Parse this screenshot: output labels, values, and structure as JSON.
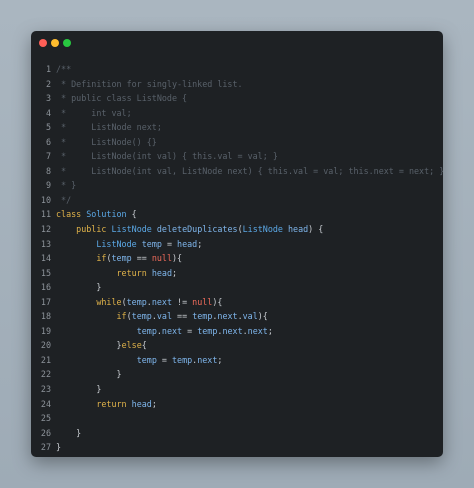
{
  "window": {
    "controls": {
      "close_color": "#fe5f57",
      "minimize_color": "#febc2e",
      "maximize_color": "#28c840"
    }
  },
  "editor": {
    "language": "java",
    "lines": [
      {
        "number": "1",
        "tokens": [
          {
            "t": "/**",
            "k": "comment"
          }
        ]
      },
      {
        "number": "2",
        "tokens": [
          {
            "t": " * Definition for singly-linked list.",
            "k": "comment"
          }
        ]
      },
      {
        "number": "3",
        "tokens": [
          {
            "t": " * public class ListNode {",
            "k": "comment"
          }
        ]
      },
      {
        "number": "4",
        "tokens": [
          {
            "t": " *     int val;",
            "k": "comment"
          }
        ]
      },
      {
        "number": "5",
        "tokens": [
          {
            "t": " *     ListNode next;",
            "k": "comment"
          }
        ]
      },
      {
        "number": "6",
        "tokens": [
          {
            "t": " *     ListNode() {}",
            "k": "comment"
          }
        ]
      },
      {
        "number": "7",
        "tokens": [
          {
            "t": " *     ListNode(int val) { this.val = val; }",
            "k": "comment"
          }
        ]
      },
      {
        "number": "8",
        "tokens": [
          {
            "t": " *     ListNode(int val, ListNode next) { this.val = val; this.next = next; }",
            "k": "comment"
          }
        ]
      },
      {
        "number": "9",
        "tokens": [
          {
            "t": " * }",
            "k": "comment"
          }
        ]
      },
      {
        "number": "10",
        "tokens": [
          {
            "t": " */",
            "k": "comment"
          }
        ]
      },
      {
        "number": "11",
        "tokens": [
          {
            "t": "class",
            "k": "keyword"
          },
          {
            "t": " ",
            "k": "plain"
          },
          {
            "t": "Solution",
            "k": "type"
          },
          {
            "t": " {",
            "k": "plain"
          }
        ]
      },
      {
        "number": "12",
        "tokens": [
          {
            "t": "    ",
            "k": "plain"
          },
          {
            "t": "public",
            "k": "keyword"
          },
          {
            "t": " ",
            "k": "plain"
          },
          {
            "t": "ListNode",
            "k": "type"
          },
          {
            "t": " ",
            "k": "plain"
          },
          {
            "t": "deleteDuplicates",
            "k": "ident"
          },
          {
            "t": "(",
            "k": "plain"
          },
          {
            "t": "ListNode",
            "k": "type"
          },
          {
            "t": " ",
            "k": "plain"
          },
          {
            "t": "head",
            "k": "ident"
          },
          {
            "t": ") {",
            "k": "plain"
          }
        ]
      },
      {
        "number": "13",
        "tokens": [
          {
            "t": "        ",
            "k": "plain"
          },
          {
            "t": "ListNode",
            "k": "type"
          },
          {
            "t": " ",
            "k": "plain"
          },
          {
            "t": "temp",
            "k": "ident"
          },
          {
            "t": " = ",
            "k": "plain"
          },
          {
            "t": "head",
            "k": "ident"
          },
          {
            "t": ";",
            "k": "plain"
          }
        ]
      },
      {
        "number": "14",
        "tokens": [
          {
            "t": "        ",
            "k": "plain"
          },
          {
            "t": "if",
            "k": "keyword"
          },
          {
            "t": "(",
            "k": "plain"
          },
          {
            "t": "temp",
            "k": "ident"
          },
          {
            "t": " == ",
            "k": "plain"
          },
          {
            "t": "null",
            "k": "null"
          },
          {
            "t": "){",
            "k": "plain"
          }
        ]
      },
      {
        "number": "15",
        "tokens": [
          {
            "t": "            ",
            "k": "plain"
          },
          {
            "t": "return",
            "k": "keyword"
          },
          {
            "t": " ",
            "k": "plain"
          },
          {
            "t": "head",
            "k": "ident"
          },
          {
            "t": ";",
            "k": "plain"
          }
        ]
      },
      {
        "number": "16",
        "tokens": [
          {
            "t": "        }",
            "k": "plain"
          }
        ]
      },
      {
        "number": "17",
        "tokens": [
          {
            "t": "        ",
            "k": "plain"
          },
          {
            "t": "while",
            "k": "keyword"
          },
          {
            "t": "(",
            "k": "plain"
          },
          {
            "t": "temp",
            "k": "ident"
          },
          {
            "t": ".",
            "k": "plain"
          },
          {
            "t": "next",
            "k": "ident"
          },
          {
            "t": " != ",
            "k": "plain"
          },
          {
            "t": "null",
            "k": "null"
          },
          {
            "t": "){",
            "k": "plain"
          }
        ]
      },
      {
        "number": "18",
        "tokens": [
          {
            "t": "            ",
            "k": "plain"
          },
          {
            "t": "if",
            "k": "keyword"
          },
          {
            "t": "(",
            "k": "plain"
          },
          {
            "t": "temp",
            "k": "ident"
          },
          {
            "t": ".",
            "k": "plain"
          },
          {
            "t": "val",
            "k": "ident"
          },
          {
            "t": " == ",
            "k": "plain"
          },
          {
            "t": "temp",
            "k": "ident"
          },
          {
            "t": ".",
            "k": "plain"
          },
          {
            "t": "next",
            "k": "ident"
          },
          {
            "t": ".",
            "k": "plain"
          },
          {
            "t": "val",
            "k": "ident"
          },
          {
            "t": "){",
            "k": "plain"
          }
        ]
      },
      {
        "number": "19",
        "tokens": [
          {
            "t": "                ",
            "k": "plain"
          },
          {
            "t": "temp",
            "k": "ident"
          },
          {
            "t": ".",
            "k": "plain"
          },
          {
            "t": "next",
            "k": "ident"
          },
          {
            "t": " = ",
            "k": "plain"
          },
          {
            "t": "temp",
            "k": "ident"
          },
          {
            "t": ".",
            "k": "plain"
          },
          {
            "t": "next",
            "k": "ident"
          },
          {
            "t": ".",
            "k": "plain"
          },
          {
            "t": "next",
            "k": "ident"
          },
          {
            "t": ";",
            "k": "plain"
          }
        ]
      },
      {
        "number": "20",
        "tokens": [
          {
            "t": "            }",
            "k": "plain"
          },
          {
            "t": "else",
            "k": "keyword"
          },
          {
            "t": "{",
            "k": "plain"
          }
        ]
      },
      {
        "number": "21",
        "tokens": [
          {
            "t": "                ",
            "k": "plain"
          },
          {
            "t": "temp",
            "k": "ident"
          },
          {
            "t": " = ",
            "k": "plain"
          },
          {
            "t": "temp",
            "k": "ident"
          },
          {
            "t": ".",
            "k": "plain"
          },
          {
            "t": "next",
            "k": "ident"
          },
          {
            "t": ";",
            "k": "plain"
          }
        ]
      },
      {
        "number": "22",
        "tokens": [
          {
            "t": "            }",
            "k": "plain"
          }
        ]
      },
      {
        "number": "23",
        "tokens": [
          {
            "t": "        }",
            "k": "plain"
          }
        ]
      },
      {
        "number": "24",
        "tokens": [
          {
            "t": "        ",
            "k": "plain"
          },
          {
            "t": "return",
            "k": "keyword"
          },
          {
            "t": " ",
            "k": "plain"
          },
          {
            "t": "head",
            "k": "ident"
          },
          {
            "t": ";",
            "k": "plain"
          }
        ]
      },
      {
        "number": "25",
        "tokens": [
          {
            "t": "",
            "k": "plain"
          }
        ]
      },
      {
        "number": "26",
        "tokens": [
          {
            "t": "    }",
            "k": "plain"
          }
        ]
      },
      {
        "number": "27",
        "tokens": [
          {
            "t": "}",
            "k": "plain"
          }
        ]
      }
    ]
  }
}
